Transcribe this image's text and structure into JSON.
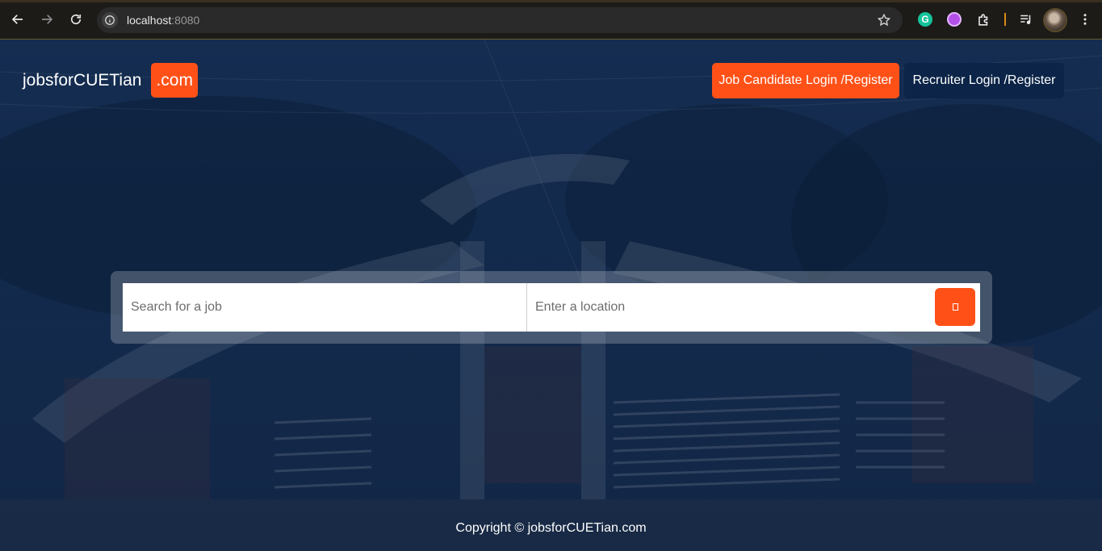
{
  "browser": {
    "url_host": "localhost",
    "url_port": ":8080"
  },
  "header": {
    "brand_name": "jobsforCUETian",
    "brand_suffix": ".com",
    "candidate_button": "Job Candidate Login /Register",
    "recruiter_button": "Recruiter Login /Register"
  },
  "search": {
    "job_placeholder": "Search for a job",
    "location_placeholder": "Enter a location"
  },
  "footer": {
    "copyright": "Copyright © jobsforCUETian.com"
  },
  "colors": {
    "accent": "#ff5117",
    "navy": "#0b2447"
  }
}
